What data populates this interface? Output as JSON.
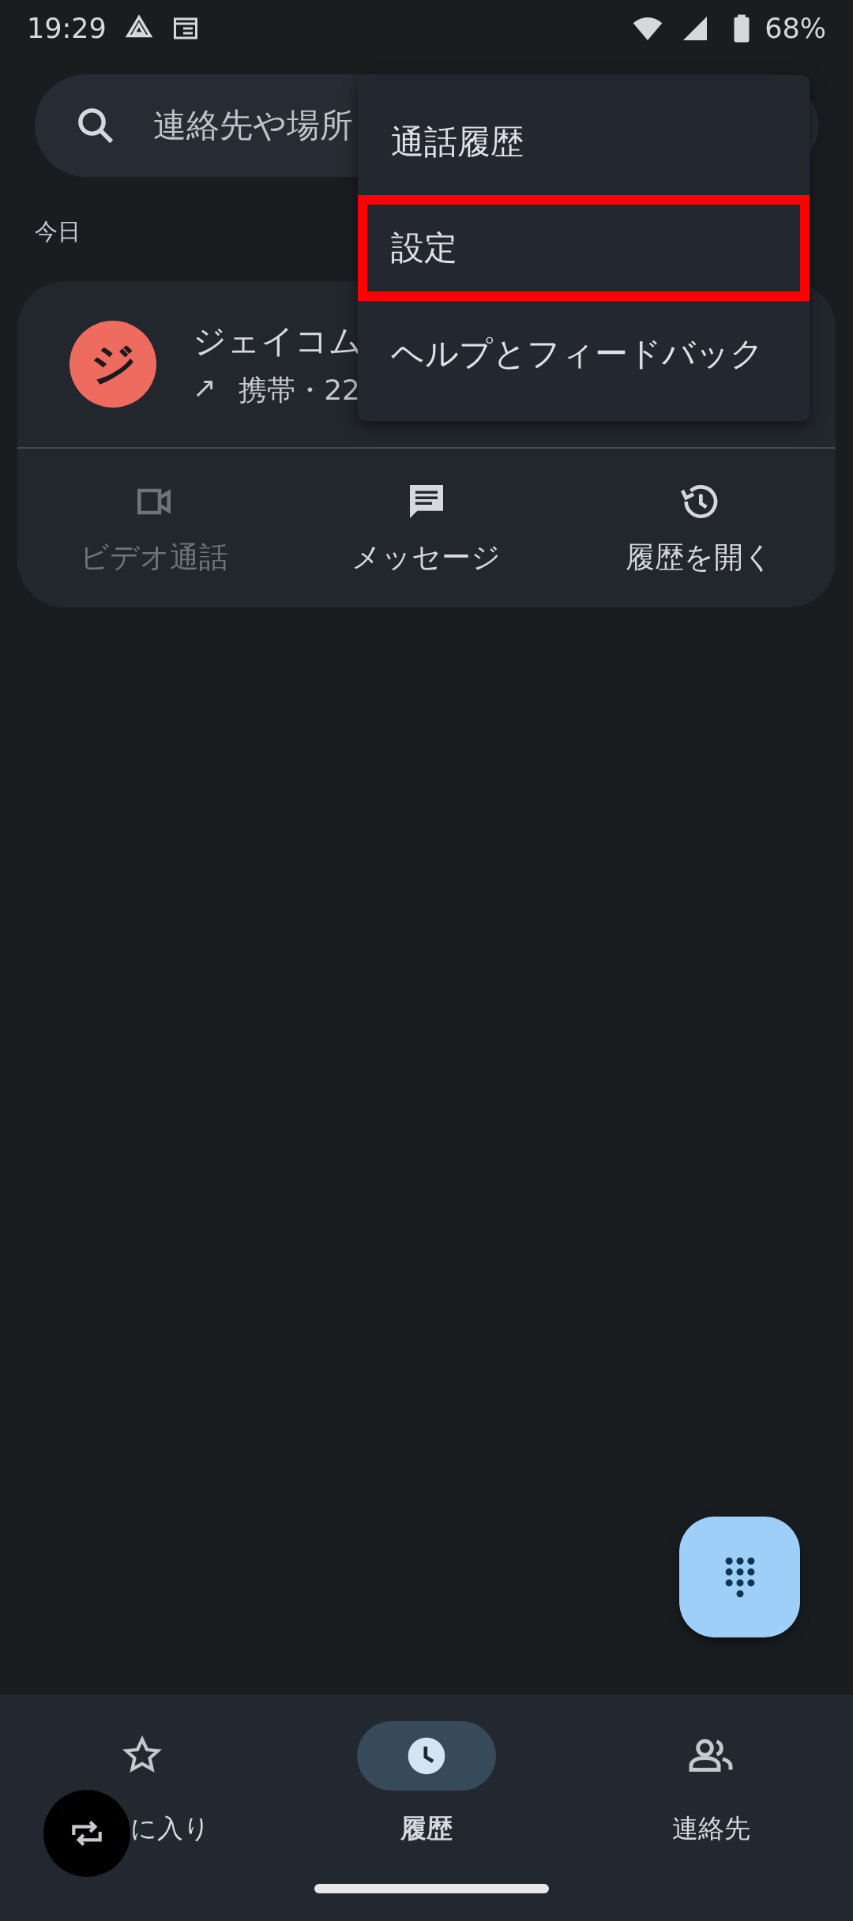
{
  "status_bar": {
    "time": "19:29",
    "battery": "68%"
  },
  "search": {
    "placeholder": "連絡先や場所"
  },
  "section_header": "今日",
  "call": {
    "avatar_letter": "ジ",
    "name": "ジェイコム",
    "direction": "↗",
    "detail": "携帯・22",
    "actions": [
      {
        "label": "ビデオ通話",
        "kind": "video",
        "disabled": true
      },
      {
        "label": "メッセージ",
        "kind": "message",
        "disabled": false
      },
      {
        "label": "履歴を開く",
        "kind": "history",
        "disabled": false
      }
    ]
  },
  "menu": {
    "items": [
      {
        "label": "通話履歴",
        "highlighted": false
      },
      {
        "label": "設定",
        "highlighted": true
      },
      {
        "label": "ヘルプとフィードバック",
        "highlighted": false
      }
    ]
  },
  "bottom_nav": [
    {
      "label": "に入り",
      "kind": "star",
      "selected": false
    },
    {
      "label": "履歴",
      "kind": "clock",
      "selected": true
    },
    {
      "label": "連絡先",
      "kind": "people",
      "selected": false
    }
  ]
}
